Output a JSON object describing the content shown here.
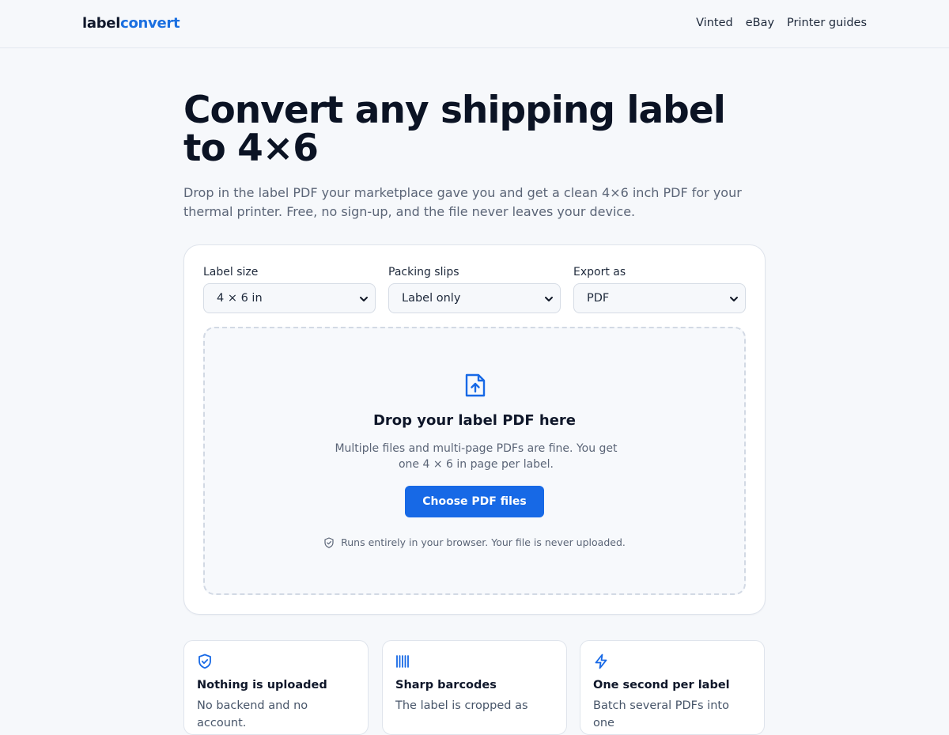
{
  "brand": {
    "part1": "label",
    "part2": "convert"
  },
  "nav": {
    "items": [
      "Vinted",
      "eBay",
      "Printer guides"
    ]
  },
  "hero": {
    "title": "Convert any shipping label to 4×6",
    "lede": "Drop in the label PDF your marketplace gave you and get a clean 4×6 inch PDF for your thermal printer. Free, no sign-up, and the file never leaves your device."
  },
  "options": {
    "label_size": {
      "label": "Label size",
      "value": "4 × 6 in"
    },
    "packing_slips": {
      "label": "Packing slips",
      "value": "Label only"
    },
    "export_as": {
      "label": "Export as",
      "value": "PDF"
    }
  },
  "dropzone": {
    "title": "Drop your label PDF here",
    "subtitle": "Multiple files and multi-page PDFs are fine. You get one 4 × 6 in page per label.",
    "button": "Choose PDF files",
    "privacy": "Runs entirely in your browser. Your file is never uploaded."
  },
  "features": [
    {
      "icon": "shield-check-icon",
      "title": "Nothing is uploaded",
      "desc": "No backend and no account."
    },
    {
      "icon": "barcode-icon",
      "title": "Sharp barcodes",
      "desc": "The label is cropped as"
    },
    {
      "icon": "lightning-icon",
      "title": "One second per label",
      "desc": "Batch several PDFs into one"
    }
  ],
  "colors": {
    "accent": "#1769e6",
    "brand_blue": "#1a6fe0",
    "text": "#0f172a",
    "muted": "#5b6577"
  }
}
